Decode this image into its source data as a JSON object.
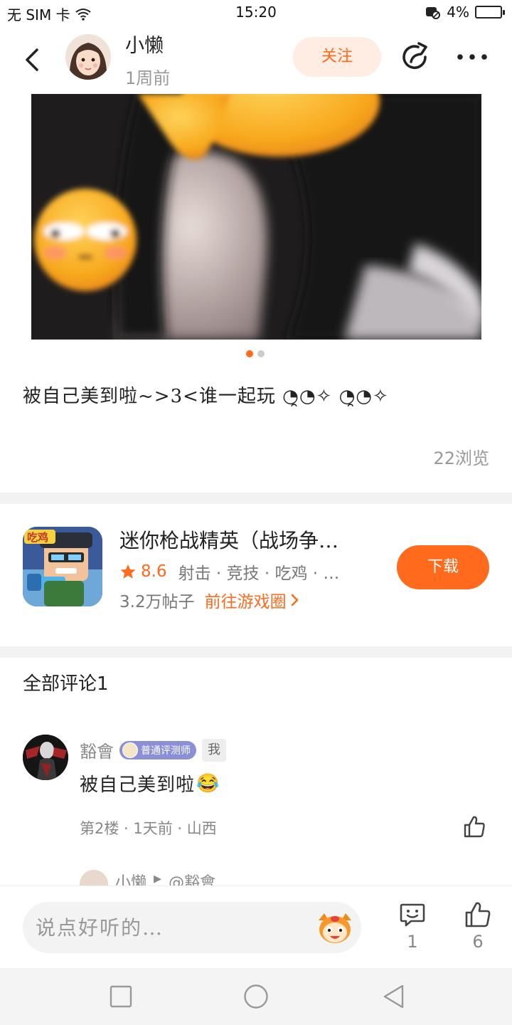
{
  "status_bar": {
    "carrier": "无 SIM 卡",
    "time": "15:20",
    "battery_pct": "4%",
    "icons": [
      "wifi-icon",
      "screen-record-icon",
      "battery-icon"
    ]
  },
  "header": {
    "author_name": "小懒",
    "post_time": "1周前",
    "follow_label": "关注",
    "icons": [
      "back-arrow-icon",
      "share-icon",
      "more-icon"
    ]
  },
  "post": {
    "image_count": 2,
    "active_image_index": 0,
    "text": "被自己美到啦~>3<谁一起玩 ◔̯◔✧ ◔̯◔✧",
    "views": "22浏览"
  },
  "game_card": {
    "title": "迷你枪战精英（战场争…",
    "rating": "8.6",
    "tags": "射击 · 竞技 · 吃鸡 · …",
    "posts": "3.2万帖子",
    "goto_label": "前往游戏圈",
    "download_label": "下载",
    "accent_color": "#ff6a1c"
  },
  "comments": {
    "title": "全部评论1",
    "items": [
      {
        "name": "豁會",
        "badge": "普通评测师",
        "me_tag": "我",
        "text": "被自己美到啦",
        "emoji": "😂",
        "meta": "第2楼 · 1天前 · 山西"
      }
    ],
    "reply_preview": {
      "name": "小懒",
      "arrow": "▸",
      "target": "@豁會"
    }
  },
  "bottom_bar": {
    "input_placeholder": "说点好听的…",
    "comment_count": "1",
    "like_count": "6"
  }
}
